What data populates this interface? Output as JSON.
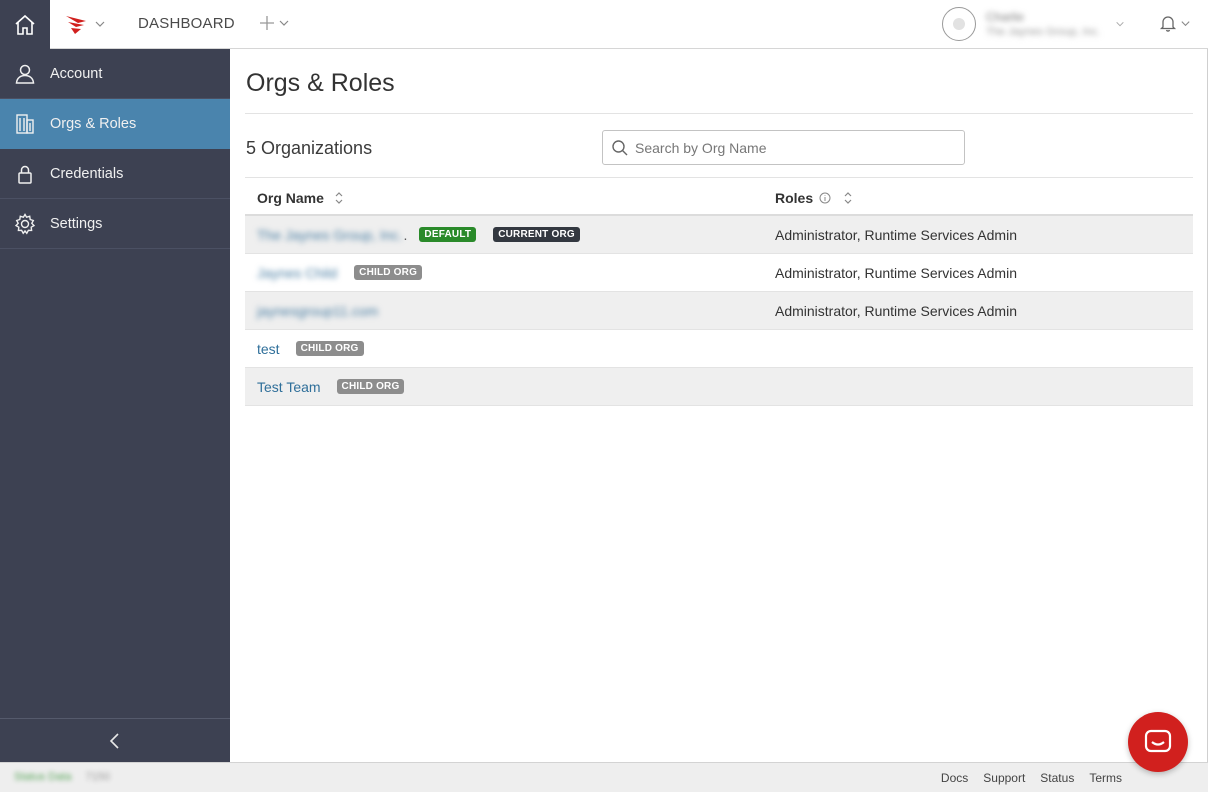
{
  "header": {
    "dashboard_label": "DASHBOARD",
    "user_name": "Charlie",
    "user_org": "The Jaynes Group, Inc.",
    "brand_color": "#d1201e"
  },
  "sidebar": {
    "items": [
      {
        "label": "Account",
        "icon": "user-icon"
      },
      {
        "label": "Orgs & Roles",
        "icon": "building-icon"
      },
      {
        "label": "Credentials",
        "icon": "lock-icon"
      },
      {
        "label": "Settings",
        "icon": "gear-icon"
      }
    ],
    "active_index": 1
  },
  "main": {
    "title": "Orgs & Roles",
    "org_count": "5 Organizations",
    "search_placeholder": "Search by Org Name",
    "columns": {
      "org_name": "Org Name",
      "roles": "Roles"
    },
    "rows": [
      {
        "name": "The Jaynes Group, Inc.",
        "badges": [
          "DEFAULT",
          "CURRENT ORG"
        ],
        "roles": "Administrator, Runtime Services Admin"
      },
      {
        "name": "Jaynes Child",
        "badges": [
          "CHILD ORG"
        ],
        "roles": "Administrator, Runtime Services Admin"
      },
      {
        "name": "jaynesgroup11.com",
        "badges": [],
        "roles": "Administrator, Runtime Services Admin"
      },
      {
        "name": "test",
        "badges": [
          "CHILD ORG"
        ],
        "roles": ""
      },
      {
        "name": "Test Team",
        "badges": [
          "CHILD ORG"
        ],
        "roles": ""
      }
    ]
  },
  "footer": {
    "status_text": "Status Data",
    "version": "7150",
    "links": [
      "Docs",
      "Support",
      "Status",
      "Terms"
    ]
  }
}
